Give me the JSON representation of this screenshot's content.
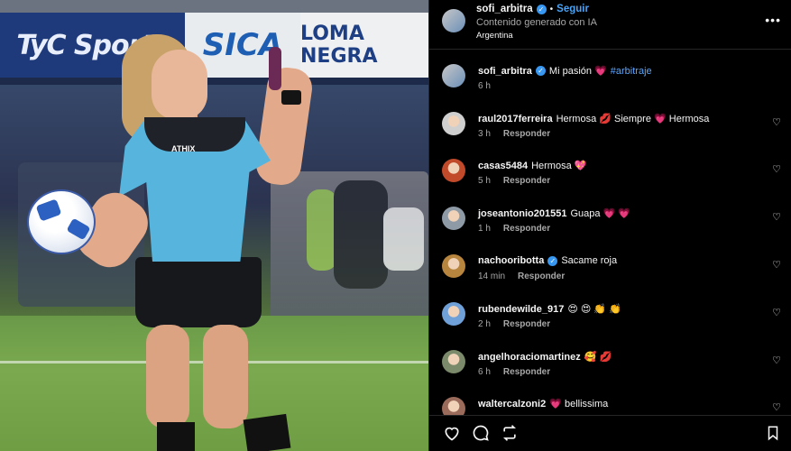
{
  "photo": {
    "banners": [
      "TyC Sports",
      "SICA",
      "LOMA NEGRA"
    ],
    "shirt_logo": "ATHIX"
  },
  "header": {
    "username": "sofi_arbitra",
    "verified": true,
    "separator": "•",
    "follow_label": "Seguir",
    "subtitle": "Contenido generado con IA",
    "location": "Argentina",
    "more_icon": "more-options-icon"
  },
  "caption": {
    "username": "sofi_arbitra",
    "verified": true,
    "text": "Mi pasión 💗",
    "hashtag": "#arbitraje",
    "time": "6 h"
  },
  "comments": [
    {
      "username": "raul2017ferreira",
      "verified": false,
      "text": "Hermosa 💋 Siempre 💗 Hermosa",
      "time": "3 h",
      "reply_label": "Responder",
      "avatar_color": "#cfcfcf"
    },
    {
      "username": "casas5484",
      "verified": false,
      "text": "Hermosa 💖",
      "time": "5 h",
      "reply_label": "Responder",
      "avatar_color": "#c04a2a"
    },
    {
      "username": "joseantonio201551",
      "verified": false,
      "text": "Guapa 💗 💗",
      "time": "1 h",
      "reply_label": "Responder",
      "avatar_color": "#8e9aa6"
    },
    {
      "username": "nachooribotta",
      "verified": true,
      "text": "Sacame roja",
      "time": "14 min",
      "reply_label": "Responder",
      "avatar_color": "#b8853e"
    },
    {
      "username": "rubendewilde_917",
      "verified": false,
      "text": "😍 😍 👏 👏",
      "time": "2 h",
      "reply_label": "Responder",
      "avatar_color": "#6fa0d8"
    },
    {
      "username": "angelhoraciomartinez",
      "verified": false,
      "text": "🥰 💋",
      "time": "6 h",
      "reply_label": "Responder",
      "avatar_color": "#7b8a6a"
    },
    {
      "username": "waltercalzoni2",
      "verified": false,
      "text": "💗 bellissima",
      "time": "",
      "reply_label": "",
      "avatar_color": "#9a6a5a"
    }
  ],
  "footer": {
    "icons": [
      "heart-icon",
      "comment-icon",
      "repost-icon",
      "bookmark-icon"
    ]
  },
  "colors": {
    "accent": "#4aa3f5",
    "verified": "#3897f0",
    "background": "#000000",
    "muted": "#a8a8a8"
  }
}
